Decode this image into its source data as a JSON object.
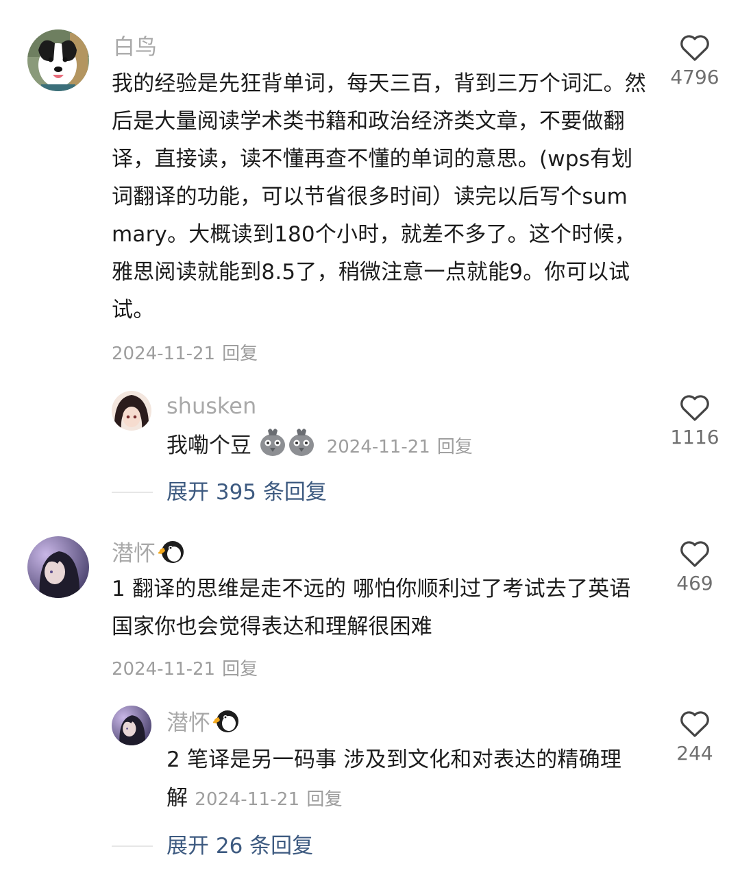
{
  "comments": [
    {
      "username": "白鸟",
      "text": "我的经验是先狂背单词，每天三百，背到三万个词汇。然后是大量阅读学术类书籍和政治经济类文章，不要做翻译，直接读，读不懂再查不懂的单词的意思。(wps有划词翻译的功能，可以节省很多时间）读完以后写个summary。大概读到180个小时，就差不多了。这个时候，雅思阅读就能到8.5了，稍微注意一点就能9。你可以试试。",
      "date": "2024-11-21",
      "reply_label": "回复",
      "likes": "4796",
      "avatar_icon": "dog-avatar-icon",
      "reply": {
        "username": "shusken",
        "text": "我嘞个豆",
        "emoji": [
          "rooster-emoji-icon",
          "rooster-emoji-icon"
        ],
        "date": "2024-11-21",
        "reply_label": "回复",
        "likes": "1116",
        "avatar_icon": "anime-girl-avatar-icon"
      },
      "expand_label": "展开 395 条回复"
    },
    {
      "username": "潜怀",
      "username_emoji": "penguin-icon",
      "text": "1 翻译的思维是走不远的 哪怕你顺利过了考试去了英语国家你也会觉得表达和理解很困难",
      "date": "2024-11-21",
      "reply_label": "回复",
      "likes": "469",
      "avatar_icon": "anime-boy-avatar-icon",
      "reply": {
        "username": "潜怀",
        "username_emoji": "penguin-icon",
        "text": "2 笔译是另一码事 涉及到文化和对表达的精确理解",
        "date": "2024-11-21",
        "reply_label": "回复",
        "likes": "244",
        "avatar_icon": "anime-boy-avatar-icon"
      },
      "expand_label": "展开 26 条回复"
    }
  ],
  "colors": {
    "username": "#a9a9a9",
    "body": "#1c1c1c",
    "meta": "#9e9e9e",
    "expand": "#3d5a80",
    "heart": "#444444"
  }
}
